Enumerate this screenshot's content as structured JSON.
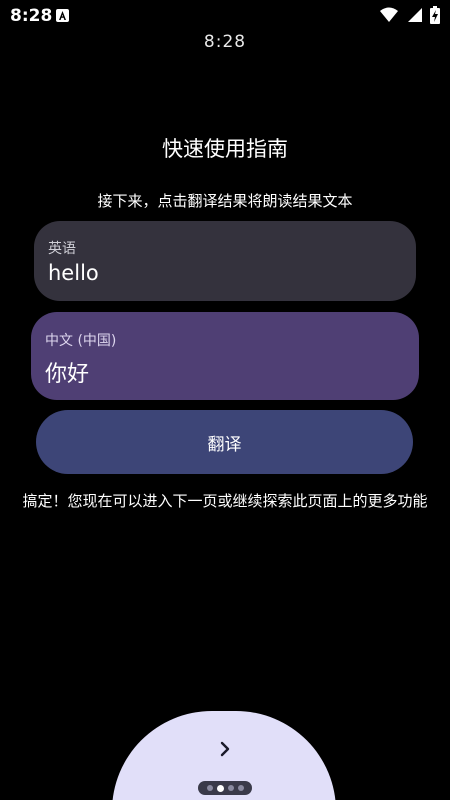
{
  "status_bar": {
    "time": "8:28",
    "icons": [
      "notification-a-icon",
      "wifi-icon",
      "signal-icon",
      "battery-charging-icon"
    ]
  },
  "watch": {
    "time": "8:28"
  },
  "guide": {
    "title": "快速使用指南",
    "subtitle": "接下来，点击翻译结果将朗读结果文本"
  },
  "source_card": {
    "language": "英语",
    "text": "hello"
  },
  "target_card": {
    "language": "中文 (中国)",
    "text": "你好"
  },
  "translate_button": {
    "label": "翻译"
  },
  "done_message": "搞定！您现在可以进入下一页或继续探索此页面上的更多功能",
  "pagination": {
    "total": 4,
    "current": 2
  },
  "colors": {
    "background": "#000000",
    "source_card": "#34323d",
    "target_card": "#4f3f74",
    "translate_button": "#3d4577",
    "next_area": "#e1dff9"
  }
}
